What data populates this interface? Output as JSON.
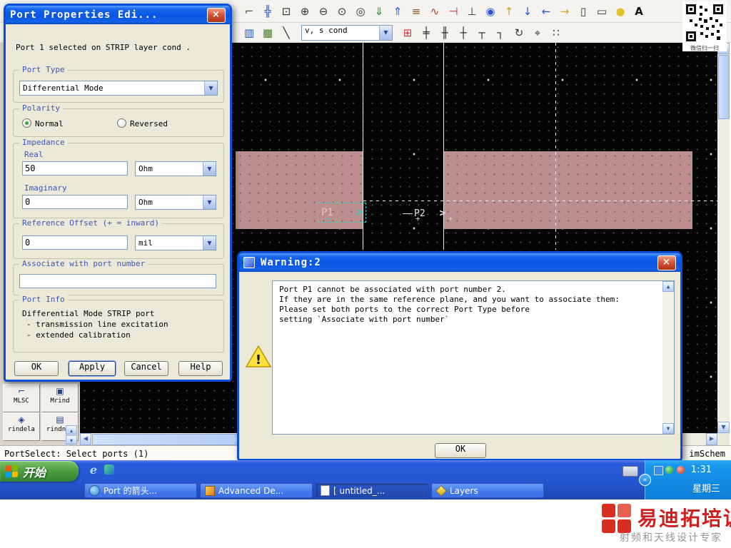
{
  "colors": {
    "xp_title_blue": "#0b4fd8",
    "taskbar_blue": "#2a5ada",
    "start_green": "#4d9f42",
    "tray_blue": "#0e7fd8",
    "conductor_pink": "#bc8f8f",
    "selection_teal": "#3ad2c2",
    "dialog_bg": "#ece9d8",
    "warning_yellow": "#ffe23c",
    "watermark_red": "#cf2020"
  },
  "glyphs": {
    "close": "×",
    "dropdown": "▼",
    "up": "▲",
    "down": "▼",
    "left": "◀",
    "right": "▶",
    "small_up": "▴",
    "small_down": "▾",
    "chevron_left": "«",
    "port_arrow": ">",
    "plus_mark": "+"
  },
  "toolbar": {
    "row1": [
      {
        "name": "orient-icon",
        "glyph": "⌐"
      },
      {
        "name": "move-icon",
        "glyph": "╬"
      },
      {
        "name": "zoom-area-icon",
        "glyph": "⊡"
      },
      {
        "name": "zoom-in-icon",
        "glyph": "⊕"
      },
      {
        "name": "zoom-out-icon",
        "glyph": "⊖"
      },
      {
        "name": "zoom-point-icon",
        "glyph": "⊙"
      },
      {
        "name": "zoom-full-icon",
        "glyph": "◎"
      },
      {
        "name": "import-icon",
        "glyph": "⇓"
      },
      {
        "name": "export-icon",
        "glyph": "⇑"
      },
      {
        "name": "library-icon",
        "glyph": "≡"
      },
      {
        "name": "wire-icon",
        "glyph": "∿"
      },
      {
        "name": "port-icon",
        "glyph": "⊣"
      },
      {
        "name": "ground-icon",
        "glyph": "⊥"
      },
      {
        "name": "via-icon",
        "glyph": "◉"
      },
      {
        "name": "arrow-up-icon",
        "glyph": "↑"
      },
      {
        "name": "arrow-down-icon",
        "glyph": "↓"
      },
      {
        "name": "arrow-left-icon",
        "glyph": "←"
      },
      {
        "name": "arrow-right-icon",
        "glyph": "→"
      },
      {
        "name": "polygon-icon",
        "glyph": "▯"
      },
      {
        "name": "rectangle-icon",
        "glyph": "▭"
      },
      {
        "name": "circle-icon",
        "glyph": "●"
      },
      {
        "name": "text-icon",
        "glyph": "A"
      }
    ],
    "row2a": [
      {
        "name": "via-array-icon",
        "glyph": "▥"
      },
      {
        "name": "draw-pin-icon",
        "glyph": "▦"
      },
      {
        "name": "line-icon",
        "glyph": "╲"
      }
    ],
    "layer_combo": {
      "value": "v, s cond"
    },
    "row2b": [
      {
        "name": "port-ref-icon",
        "glyph": "⊞"
      },
      {
        "name": "edge-port-icon",
        "glyph": "╪"
      },
      {
        "name": "offset-port-icon",
        "glyph": "╫"
      },
      {
        "name": "stretch-icon",
        "glyph": "┼"
      },
      {
        "name": "tee-icon",
        "glyph": "┬"
      },
      {
        "name": "corner-icon",
        "glyph": "┐"
      },
      {
        "name": "rotate-icon",
        "glyph": "↻"
      },
      {
        "name": "coord-icon",
        "glyph": "⌖"
      },
      {
        "name": "grid-icon",
        "glyph": "∷"
      }
    ]
  },
  "port_dialog": {
    "title": "Port Properties Edi...",
    "info": "Port 1 selected on STRIP layer cond .",
    "port_type": {
      "label": "Port Type",
      "value": "Differential Mode"
    },
    "polarity": {
      "label": "Polarity",
      "options": [
        {
          "label": "Normal",
          "selected": true
        },
        {
          "label": "Reversed",
          "selected": false
        }
      ]
    },
    "impedance": {
      "label": "Impedance",
      "real_label": "Real",
      "real_value": "50",
      "real_unit": "Ohm",
      "imag_label": "Imaginary",
      "imag_value": "0",
      "imag_unit": "Ohm"
    },
    "ref_offset": {
      "label": "Reference Offset (+ = inward)",
      "value": "0",
      "unit": "mil"
    },
    "associate": {
      "label": "Associate with port number",
      "value": ""
    },
    "port_info": {
      "label": "Port Info",
      "lines": [
        "Differential Mode STRIP port",
        "- transmission line excitation",
        "- extended calibration"
      ]
    },
    "buttons": {
      "ok": "OK",
      "apply": "Apply",
      "cancel": "Cancel",
      "help": "Help"
    }
  },
  "warning_dialog": {
    "title": "Warning:2",
    "lines": [
      "Port P1 cannot be associated with port number 2.",
      "If they are in the same reference plane, and you want to associate them:",
      "Please set both ports to the correct Port Type before",
      "setting `Associate with port number`"
    ],
    "ok": "OK"
  },
  "canvas": {
    "p1_label": "P1",
    "p2_label": "P2"
  },
  "palette": {
    "items": [
      {
        "label": "MLSC",
        "glyph": "⌐"
      },
      {
        "label": "Mrind",
        "glyph": "▣"
      },
      {
        "label": "rindela",
        "glyph": "◈"
      },
      {
        "label": "rindnbr",
        "glyph": "▤"
      }
    ]
  },
  "statusbar": {
    "message": "PortSelect: Select ports (1)",
    "right": "imSchem"
  },
  "taskbar": {
    "start": "开始",
    "tasks": [
      {
        "label": "Port 的箭头..."
      },
      {
        "label": "Advanced De..."
      },
      {
        "label": "[ untitled_..."
      },
      {
        "label": "Layers"
      }
    ],
    "tray": {
      "time": "1:31",
      "day": "星期三"
    }
  },
  "qr": {
    "caption": "微信扫一扫"
  },
  "watermark": {
    "title": "易迪拓培训",
    "subtitle": "射频和天线设计专家"
  }
}
